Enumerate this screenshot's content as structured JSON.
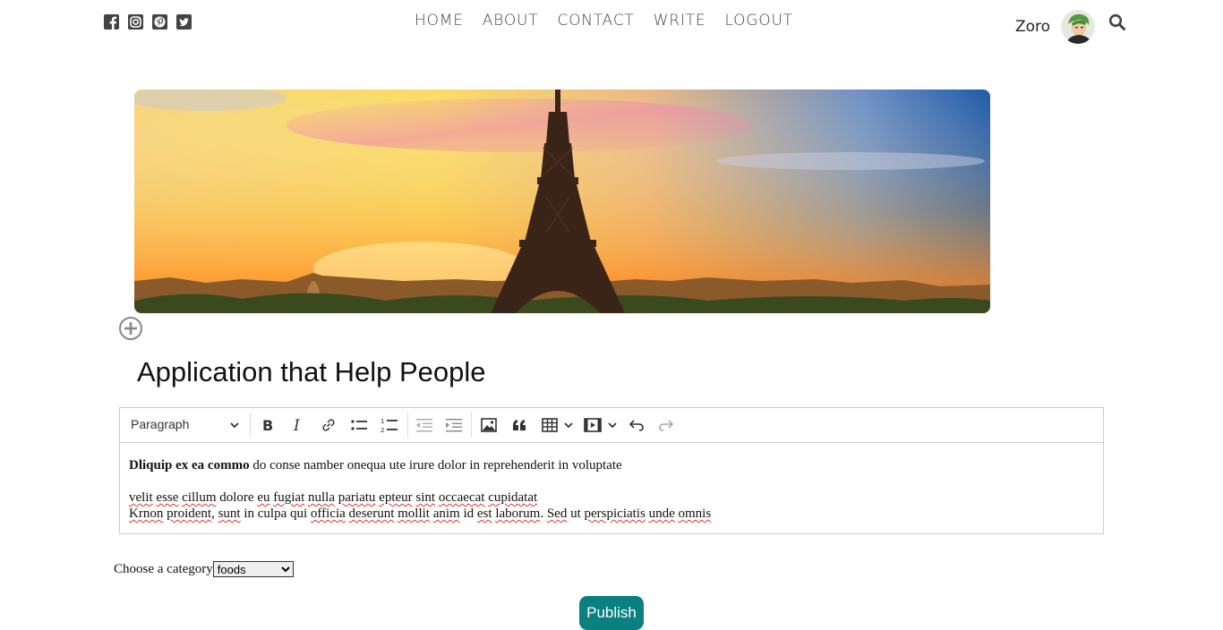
{
  "nav": {
    "social_icons": [
      "facebook-icon",
      "instagram-icon",
      "pinterest-icon",
      "twitter-icon"
    ],
    "links": [
      "HOME",
      "ABOUT",
      "CONTACT",
      "WRITE",
      "LOGOUT"
    ],
    "username": "Zoro",
    "search_icon": "search-icon"
  },
  "post": {
    "title": "Application that Help People"
  },
  "editor": {
    "format_select": "Paragraph",
    "toolbar_icons": [
      "bold-icon",
      "italic-icon",
      "link-icon",
      "bulleted-list-icon",
      "numbered-list-icon",
      "outdent-icon",
      "indent-icon",
      "image-icon",
      "blockquote-icon",
      "table-icon",
      "media-icon",
      "undo-icon",
      "redo-icon"
    ],
    "paragraph1_bold": "Dliquip ex ea commo",
    "paragraph1_rest": " do conse namber onequa ute irure dolor in reprehenderit in voluptate",
    "line2_words": [
      "velit",
      " ",
      "esse",
      " ",
      "cillum",
      " dolore ",
      "eu",
      " ",
      "fugiat",
      " ",
      "nulla",
      " ",
      "pariatu",
      " ",
      "epteur",
      " ",
      "sint",
      " ",
      "occaecat",
      " ",
      "cupidatat"
    ],
    "line3_words": [
      "Krnon",
      " ",
      "proident",
      ", ",
      "sunt",
      " in culpa qui ",
      "officia",
      " ",
      "deserunt",
      " ",
      "mollit",
      " ",
      "anim",
      " id ",
      "est",
      " ",
      "laborum",
      ". ",
      "Sed",
      " ut ",
      "perspiciatis",
      " ",
      "unde",
      " ",
      "omnis"
    ]
  },
  "category": {
    "label": "Choose a category",
    "selected": "foods"
  },
  "publish_label": "Publish",
  "colors": {
    "accent": "#0a8080",
    "nav_text": "#444444"
  }
}
